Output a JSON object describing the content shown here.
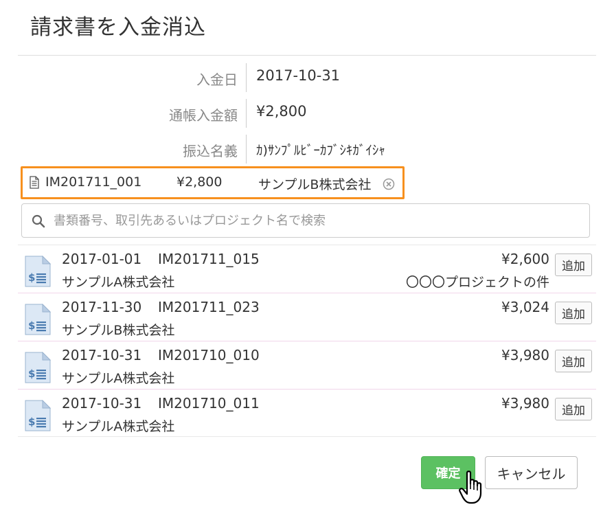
{
  "dialog": {
    "title": "請求書を入金消込"
  },
  "fields": [
    {
      "label": "入金日",
      "value": "2017-10-31"
    },
    {
      "label": "通帳入金額",
      "value": "¥2,800"
    },
    {
      "label": "振込名義",
      "value": "ｶ)ｻﾝﾌﾟﾙﾋﾞｰｶﾌﾞｼｷｶﾞｲｼｬ"
    }
  ],
  "selected": {
    "doc_no": "IM201711_001",
    "amount": "¥2,800",
    "company": "サンプルB株式会社",
    "doc_icon": "document-icon",
    "remove_icon": "close-circle-icon",
    "highlight_color": "#f7901e"
  },
  "search": {
    "placeholder": "書類番号、取引先あるいはプロジェクト名で検索",
    "icon": "search-icon"
  },
  "invoices": [
    {
      "date": "2017-01-01",
      "doc_no": "IM201711_015",
      "company": "サンプルA株式会社",
      "amount": "¥2,600",
      "project": "〇〇〇プロジェクトの件",
      "add_label": "追加"
    },
    {
      "date": "2017-11-30",
      "doc_no": "IM201711_023",
      "company": "サンプルB株式会社",
      "amount": "¥3,024",
      "project": "",
      "add_label": "追加"
    },
    {
      "date": "2017-10-31",
      "doc_no": "IM201710_010",
      "company": "サンプルA株式会社",
      "amount": "¥3,980",
      "project": "",
      "add_label": "追加"
    },
    {
      "date": "2017-10-31",
      "doc_no": "IM201710_011",
      "company": "サンプルA株式会社",
      "amount": "¥3,980",
      "project": "",
      "add_label": "追加"
    }
  ],
  "footer": {
    "confirm_label": "確定",
    "cancel_label": "キャンセル",
    "confirm_color": "#5cc162"
  }
}
